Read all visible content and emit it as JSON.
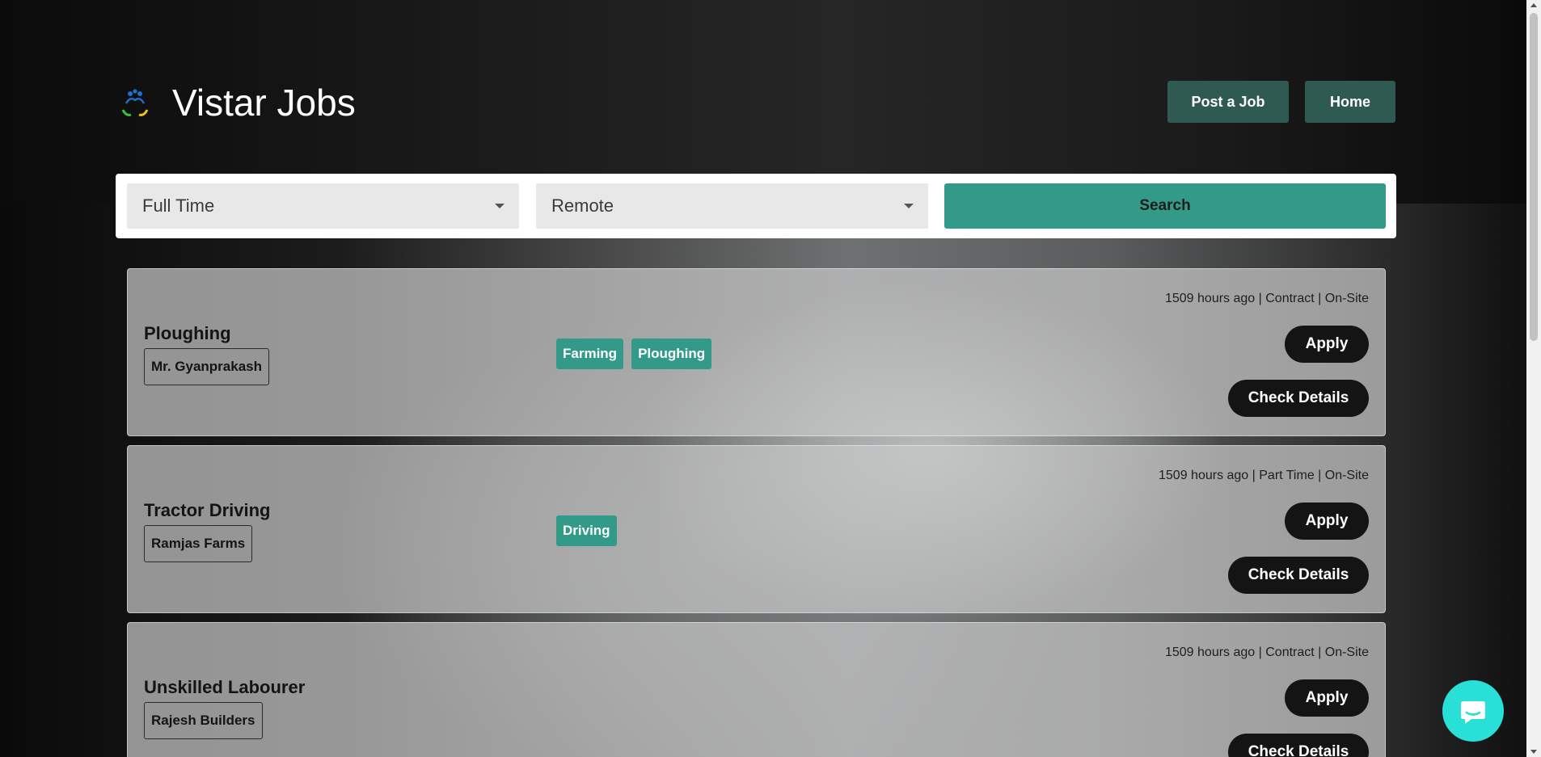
{
  "header": {
    "brand": "Vistar Jobs",
    "logo_icon": "people-hands-logo-icon",
    "nav": {
      "post_job": "Post a Job",
      "home": "Home"
    }
  },
  "search": {
    "job_type": "Full Time",
    "location_type": "Remote",
    "button": "Search"
  },
  "jobs": [
    {
      "title": "Ploughing",
      "company": "Mr. Gyanprakash",
      "tags": [
        "Farming",
        "Ploughing"
      ],
      "meta": "1509 hours ago | Contract | On-Site",
      "apply": "Apply",
      "details": "Check Details"
    },
    {
      "title": "Tractor Driving",
      "company": "Ramjas Farms",
      "tags": [
        "Driving"
      ],
      "meta": "1509 hours ago | Part Time | On-Site",
      "apply": "Apply",
      "details": "Check Details"
    },
    {
      "title": "Unskilled Labourer",
      "company": "Rajesh Builders",
      "tags": [],
      "meta": "1509 hours ago | Contract | On-Site",
      "apply": "Apply",
      "details": "Check Details"
    }
  ],
  "chat": {
    "icon": "chat-bubble-icon"
  },
  "colors": {
    "accent": "#339a89",
    "nav_button": "#2e5a52",
    "dark_button": "#141414",
    "chat": "#28e0d7"
  }
}
